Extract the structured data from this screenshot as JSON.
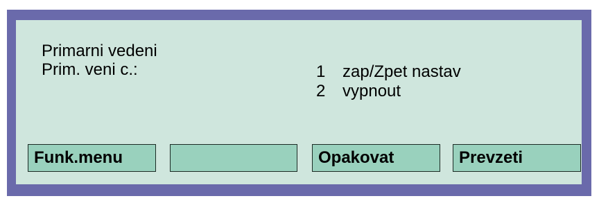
{
  "display": {
    "title": "Primarni vedeni",
    "subtitle": "Prim. veni c.:",
    "options": [
      {
        "number": "1",
        "label": "zap/Zpet nastav"
      },
      {
        "number": "2",
        "label": "vypnout"
      }
    ]
  },
  "softkeys": {
    "key1": "Funk.menu",
    "key2": "",
    "key3": "Opakovat",
    "key4": "Prevzeti"
  },
  "colors": {
    "frame": "#6a6aab",
    "screen": "#cfe6dd",
    "softkey": "#99d1bd"
  }
}
